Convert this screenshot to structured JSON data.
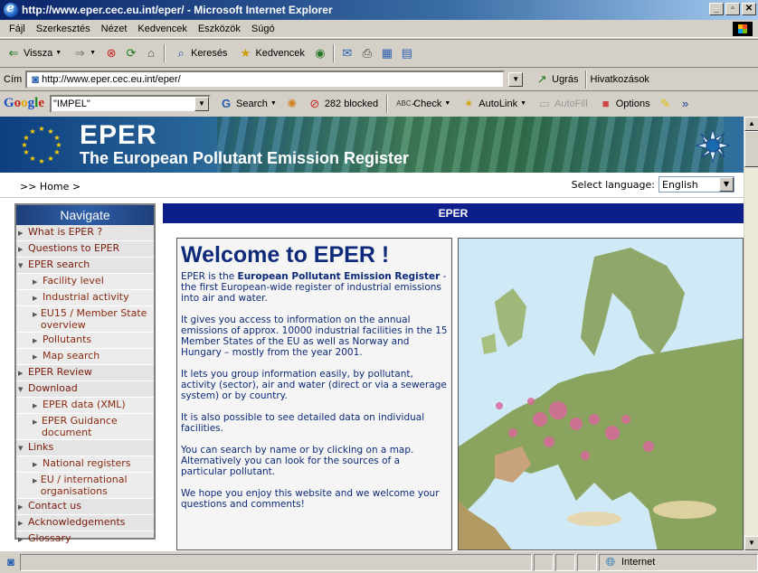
{
  "window": {
    "title": "http://www.eper.cec.eu.int/eper/ - Microsoft Internet Explorer",
    "controls": [
      "_",
      "̸",
      "X"
    ]
  },
  "menu": [
    "Fájl",
    "Szerkesztés",
    "Nézet",
    "Kedvencek",
    "Eszközök",
    "Súgó"
  ],
  "toolbar": {
    "back": "Vissza",
    "search": "Keresés",
    "favorites": "Kedvencek"
  },
  "address": {
    "label": "Cím",
    "url": "http://www.eper.cec.eu.int/eper/",
    "go": "Ugrás",
    "links": "Hivatkozások"
  },
  "google": {
    "logo": "Google",
    "query": "\"IMPEL\"",
    "search": "Search",
    "blocked": "282 blocked",
    "check": "Check",
    "autolink": "AutoLink",
    "autofill": "AutoFill",
    "options": "Options"
  },
  "banner": {
    "title": "EPER",
    "subtitle": "The European Pollutant Emission Register"
  },
  "breadcrumb": ">> Home >",
  "language": {
    "label": "Select language:",
    "selected": "English"
  },
  "nav": {
    "heading": "Navigate",
    "items": [
      {
        "label": "What is EPER ?",
        "level": 0,
        "open": false
      },
      {
        "label": "Questions to EPER",
        "level": 0,
        "open": false
      },
      {
        "label": "EPER search",
        "level": 0,
        "open": true
      },
      {
        "label": "Facility level",
        "level": 1
      },
      {
        "label": "Industrial activity",
        "level": 1
      },
      {
        "label": "EU15 / Member State overview",
        "level": 1
      },
      {
        "label": "Pollutants",
        "level": 1
      },
      {
        "label": "Map search",
        "level": 1
      },
      {
        "label": "EPER Review",
        "level": 0,
        "open": false
      },
      {
        "label": "Download",
        "level": 0,
        "open": true
      },
      {
        "label": "EPER data (XML)",
        "level": 1
      },
      {
        "label": "EPER Guidance document",
        "level": 1
      },
      {
        "label": "Links",
        "level": 0,
        "open": true
      },
      {
        "label": "National registers",
        "level": 1
      },
      {
        "label": "EU / international organisations",
        "level": 1
      },
      {
        "label": "Contact us",
        "level": 0,
        "open": false
      },
      {
        "label": "Acknowledgements",
        "level": 0,
        "open": false
      },
      {
        "label": "Glossary",
        "level": 0,
        "open": false
      }
    ]
  },
  "main": {
    "heading": "EPER",
    "welcome_title": "Welcome to EPER !",
    "intro_pre": "EPER is the ",
    "intro_bold": "European Pollutant Emission Register",
    "intro_post": " - the first European-wide register of industrial emissions into air and water.",
    "p2": "It gives you access to information on the annual emissions of approx. 10000 industrial facilities in the 15 Member States of the EU as well as Norway and Hungary – mostly from the year 2001.",
    "p3": "It lets you group information easily, by pollutant, activity (sector), air and water (direct or via a sewerage system) or by country.",
    "p4": "It is also possible to see detailed data on individual facilities.",
    "p5": "You can search by name or by clicking on a map. Alternatively you can look for the sources of a particular pollutant.",
    "p6": "We hope you enjoy this website and we welcome your questions and comments!"
  },
  "status": {
    "zone": "Internet"
  }
}
